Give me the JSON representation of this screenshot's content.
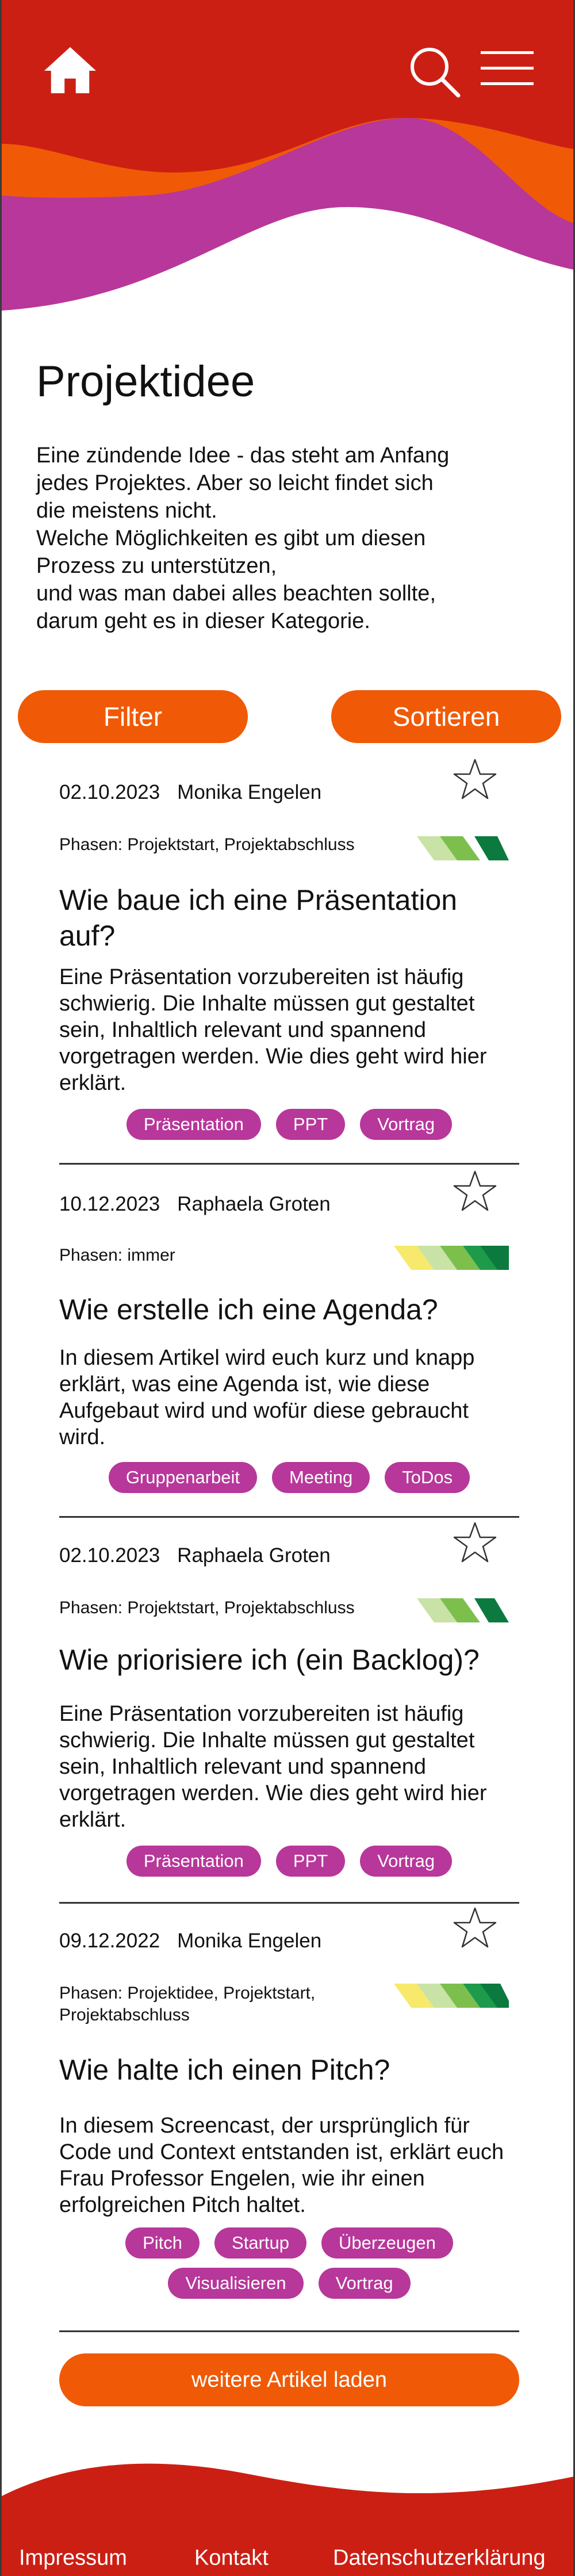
{
  "header": {
    "icons": [
      "home-icon",
      "search-icon",
      "menu-icon"
    ],
    "colors": {
      "red": "#cc1f14",
      "orange": "#f05a06",
      "magenta": "#b8379a"
    }
  },
  "main": {
    "title": "Projektidee",
    "intro": "Eine zündende Idee - das steht am Anfang\njedes Projektes. Aber so leicht findet sich\ndie meistens nicht.\nWelche Möglichkeiten es gibt um diesen\nProzess zu unterstützen,\nund was man dabei alles beachten sollte,\ndarum geht es in dieser Kategorie.",
    "filter_label": "Filter",
    "sort_label": "Sortieren"
  },
  "articles": [
    {
      "date": "02.10.2023",
      "author": "Monika Engelen",
      "phases": "Phasen: Projektstart, Projektabschluss",
      "title": "Wie baue ich eine Präsentation auf?",
      "text": "Eine Präsentation vorzubereiten ist häufig schwierig. Die Inhalte müssen gut gestaltet sein, Inhaltlich relevant und spannend vorgetragen werden. Wie dies geht wird hier erklärt.",
      "tags": [
        "Präsentation",
        "PPT",
        "Vortrag"
      ]
    },
    {
      "date": "10.12.2023",
      "author": "Raphaela Groten",
      "phases": "Phasen: immer",
      "title": "Wie erstelle ich eine Agenda?",
      "text": "In diesem Artikel wird euch kurz und knapp erklärt, was eine Agenda ist, wie diese Aufgebaut wird und wofür diese gebraucht wird.",
      "tags": [
        "Gruppenarbeit",
        "Meeting",
        "ToDos"
      ]
    },
    {
      "date": "02.10.2023",
      "author": "Raphaela Groten",
      "phases": "Phasen: Projektstart, Projektabschluss",
      "title": "Wie priorisiere ich (ein Backlog)?",
      "text": "Eine Präsentation vorzubereiten ist häufig schwierig. Die Inhalte müssen gut gestaltet sein, Inhaltlich relevant und spannend vorgetragen werden. Wie dies geht wird hier erklärt.",
      "tags": [
        "Präsentation",
        "PPT",
        "Vortrag"
      ]
    },
    {
      "date": "09.12.2022",
      "author": "Monika Engelen",
      "phases": "Phasen: Projektidee, Projektstart, Projektabschluss",
      "title": "Wie halte ich einen Pitch?",
      "text": "In diesem Screencast, der ursprünglich für Code und Context entstanden ist, erklärt euch Frau Professor Engelen, wie ihr einen erfolgreichen Pitch haltet.",
      "tags": [
        "Pitch",
        "Startup",
        "Überzeugen",
        "Visualisieren",
        "Vortrag"
      ]
    }
  ],
  "load_more_label": "weitere Artikel laden",
  "footer": {
    "impressum": "Impressum",
    "kontakt": "Kontakt",
    "datenschutz": "Datenschutzerklärung"
  }
}
